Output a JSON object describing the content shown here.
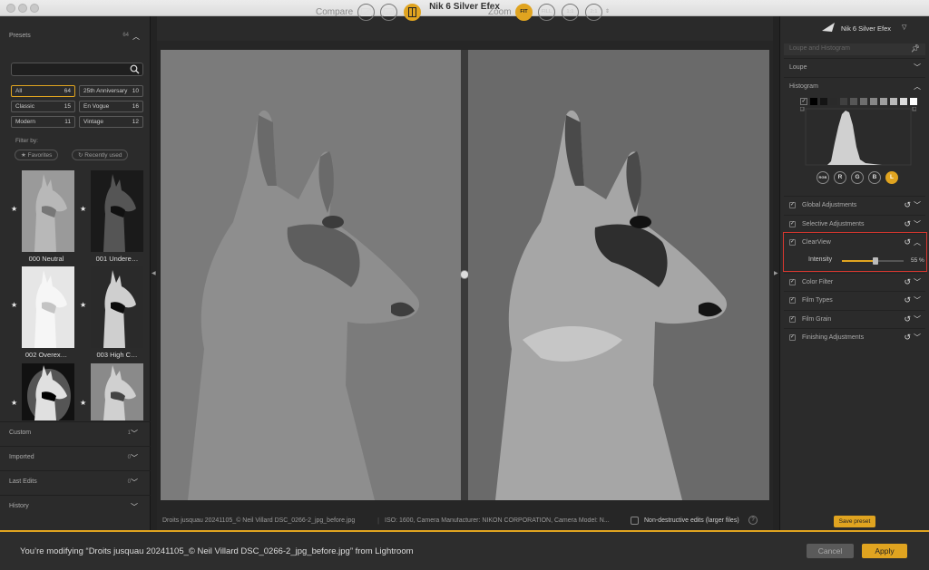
{
  "window": {
    "title": "Nik 6 Silver Efex"
  },
  "left_panel": {
    "presets_label": "Presets",
    "presets_count": "64",
    "search_placeholder": "",
    "categories": [
      {
        "name": "All",
        "count": "64",
        "selected": true
      },
      {
        "name": "25th Anniversary",
        "count": "10"
      },
      {
        "name": "Classic",
        "count": "15"
      },
      {
        "name": "En Vogue",
        "count": "16"
      },
      {
        "name": "Modern",
        "count": "11"
      },
      {
        "name": "Vintage",
        "count": "12"
      }
    ],
    "filter_by": "Filter by:",
    "filter_favorites": "★ Favorites",
    "filter_recent": "Recently used",
    "thumbnails": [
      {
        "name": "000 Neutral",
        "favorite": true
      },
      {
        "name": "001 Undere…",
        "favorite": true
      },
      {
        "name": "002 Overex…",
        "favorite": true
      },
      {
        "name": "003 High C…",
        "favorite": true
      },
      {
        "name": "",
        "favorite": true
      },
      {
        "name": "",
        "favorite": true
      }
    ],
    "sections": [
      {
        "label": "Custom",
        "count": "1"
      },
      {
        "label": "Imported",
        "count": "0"
      },
      {
        "label": "Last Edits",
        "count": "0"
      },
      {
        "label": "History",
        "count": ""
      }
    ]
  },
  "toolbar": {
    "compare_label": "Compare",
    "zoom_label": "Zoom",
    "zoom_buttons": [
      "FIT",
      "FILL",
      "1:1",
      "2:1"
    ],
    "zoom_active": "FIT"
  },
  "status": {
    "filename": "Droits jusquau 20241105_© Neil Villard DSC_0266-2_jpg_before.jpg",
    "separator": "|",
    "meta": "ISO: 1600, Camera Manufacturer: NIKON CORPORATION, Camera Model: N...",
    "nondestructive_label": "Non-destructive edits (larger files)",
    "help": "?"
  },
  "right_panel": {
    "brand": "Nik 6 Silver Efex",
    "loupe_histogram": "Loupe and Histogram",
    "loupe": "Loupe",
    "histogram": "Histogram",
    "channels": [
      "RGB",
      "R",
      "G",
      "B",
      "L"
    ],
    "active_channel": "L",
    "adjustments": [
      {
        "label": "Global Adjustments"
      },
      {
        "label": "Selective Adjustments"
      },
      {
        "label": "ClearView"
      },
      {
        "label": "Color Filter"
      },
      {
        "label": "Film Types"
      },
      {
        "label": "Film Grain"
      },
      {
        "label": "Finishing Adjustments"
      }
    ],
    "intensity_label": "Intensity",
    "intensity_value": "55 %",
    "intensity_fraction": 0.55,
    "save_preset": "Save preset"
  },
  "bottom": {
    "message": "You’re modifying “Droits jusquau 20241105_© Neil Villard DSC_0266-2_jpg_before.jpg” from Lightroom",
    "cancel": "Cancel",
    "apply": "Apply"
  },
  "colors": {
    "accent": "#e0a420",
    "highlight_box": "#d9372f"
  }
}
